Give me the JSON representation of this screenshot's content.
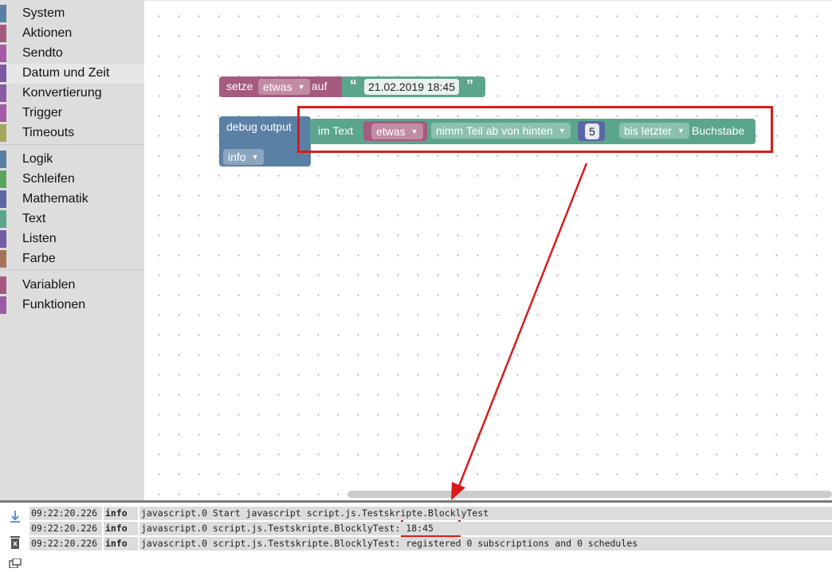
{
  "toolbox": {
    "categories": [
      {
        "label": "System",
        "color": "#5b80a5"
      },
      {
        "label": "Aktionen",
        "color": "#a55b80"
      },
      {
        "label": "Sendto",
        "color": "#a55ba5"
      },
      {
        "label": "Datum und Zeit",
        "color": "#7b5ba5"
      },
      {
        "label": "Konvertierung",
        "color": "#8a5ba5"
      },
      {
        "label": "Trigger",
        "color": "#a55ba5"
      },
      {
        "label": "Timeouts",
        "color": "#a5a55b"
      },
      {
        "label": "Logik",
        "color": "#5b80a5"
      },
      {
        "label": "Schleifen",
        "color": "#5ba55b"
      },
      {
        "label": "Mathematik",
        "color": "#5b67a5"
      },
      {
        "label": "Text",
        "color": "#5ba58c"
      },
      {
        "label": "Listen",
        "color": "#745ba5"
      },
      {
        "label": "Farbe",
        "color": "#a5745b"
      },
      {
        "label": "Variablen",
        "color": "#a55b80"
      },
      {
        "label": "Funktionen",
        "color": "#995ba5"
      }
    ]
  },
  "blocks": {
    "set_var": {
      "keyword": "setze",
      "variable": "etwas",
      "to": "auf",
      "open_quote": "“",
      "value": "21.02.2019 18:45",
      "close_quote": "”"
    },
    "debug": {
      "label": "debug output",
      "level": "info"
    },
    "substring": {
      "in_text": "im Text",
      "variable": "etwas",
      "mode": "nimm Teil ab von hinten",
      "number": "5",
      "end_mode": "bis letzter",
      "suffix": "Buchstabe"
    }
  },
  "console": {
    "rows": [
      {
        "time": "09:22:20.226",
        "level": "info",
        "message": "javascript.0 Start javascript script.js.Testskripte.BlocklyTest"
      },
      {
        "time": "09:22:20.226",
        "level": "info",
        "message": "javascript.0 script.js.Testskripte.BlocklyTest: 18:45"
      },
      {
        "time": "09:22:20.226",
        "level": "info",
        "message": "javascript.0 script.js.Testskripte.BlocklyTest: registered 0 subscriptions and 0 schedules"
      }
    ],
    "icons": [
      "scroll-down-icon",
      "clear-log-icon",
      "copy-icon"
    ]
  },
  "colors": {
    "variables": "#a55b80",
    "text": "#5ba58c",
    "debug": "#5b80a5",
    "math": "#5b67a5",
    "highlight": "#d81c1c"
  }
}
